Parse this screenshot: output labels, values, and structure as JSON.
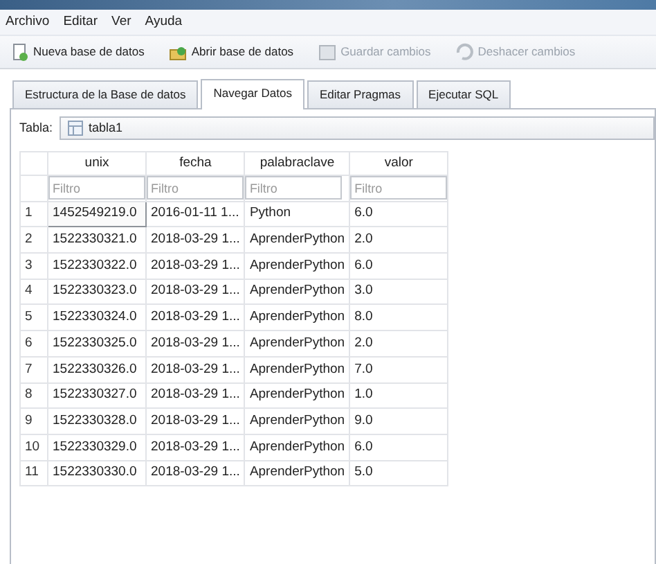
{
  "menu": [
    "Archivo",
    "Editar",
    "Ver",
    "Ayuda"
  ],
  "toolbar": [
    {
      "label": "Nueva base de datos",
      "disabled": false
    },
    {
      "label": "Abrir base de datos",
      "disabled": false
    },
    {
      "label": "Guardar cambios",
      "disabled": true
    },
    {
      "label": "Deshacer cambios",
      "disabled": true
    }
  ],
  "tabs": [
    {
      "label": "Estructura de la Base de datos",
      "selected": false
    },
    {
      "label": "Navegar Datos",
      "selected": true
    },
    {
      "label": "Editar Pragmas",
      "selected": false
    },
    {
      "label": "Ejecutar SQL",
      "selected": false
    }
  ],
  "table_select": {
    "label": "Tabla:",
    "value": "tabla1"
  },
  "table": {
    "columns": [
      "unix",
      "fecha",
      "palabraclave",
      "valor"
    ],
    "filters": [
      {
        "placeholder": "Filtro"
      },
      {
        "placeholder": "Filtro"
      },
      {
        "placeholder": "Filtro"
      },
      {
        "placeholder": "Filtro"
      }
    ],
    "rows": [
      {
        "index": "1",
        "cells": [
          "1452549219.0",
          "2016-01-11 1...",
          "Python",
          "6.0"
        ],
        "selected": true
      },
      {
        "index": "2",
        "cells": [
          "1522330321.0",
          "2018-03-29 1...",
          "AprenderPython",
          "2.0"
        ],
        "selected": false
      },
      {
        "index": "3",
        "cells": [
          "1522330322.0",
          "2018-03-29 1...",
          "AprenderPython",
          "6.0"
        ],
        "selected": false
      },
      {
        "index": "4",
        "cells": [
          "1522330323.0",
          "2018-03-29 1...",
          "AprenderPython",
          "3.0"
        ],
        "selected": false
      },
      {
        "index": "5",
        "cells": [
          "1522330324.0",
          "2018-03-29 1...",
          "AprenderPython",
          "8.0"
        ],
        "selected": false
      },
      {
        "index": "6",
        "cells": [
          "1522330325.0",
          "2018-03-29 1...",
          "AprenderPython",
          "2.0"
        ],
        "selected": false
      },
      {
        "index": "7",
        "cells": [
          "1522330326.0",
          "2018-03-29 1...",
          "AprenderPython",
          "7.0"
        ],
        "selected": false
      },
      {
        "index": "8",
        "cells": [
          "1522330327.0",
          "2018-03-29 1...",
          "AprenderPython",
          "1.0"
        ],
        "selected": false
      },
      {
        "index": "9",
        "cells": [
          "1522330328.0",
          "2018-03-29 1...",
          "AprenderPython",
          "9.0"
        ],
        "selected": false
      },
      {
        "index": "10",
        "cells": [
          "1522330329.0",
          "2018-03-29 1...",
          "AprenderPython",
          "6.0"
        ],
        "selected": false
      },
      {
        "index": "11",
        "cells": [
          "1522330330.0",
          "2018-03-29 1...",
          "AprenderPython",
          "5.0"
        ],
        "selected": false
      }
    ]
  }
}
